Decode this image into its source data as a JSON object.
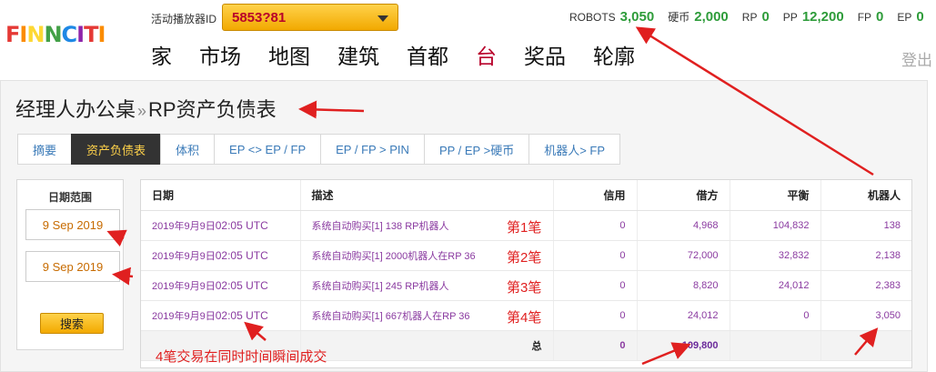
{
  "header": {
    "logo_text": "FINNCITI",
    "logo_colors": [
      "#e53935",
      "#fb8c00",
      "#fdd835",
      "#43a047",
      "#1e88e5",
      "#8e24aa",
      "#e53935",
      "#fb8c00"
    ],
    "player_label": "活动播放器ID",
    "player_id": "5853?81",
    "stats": [
      {
        "label": "ROBOTS",
        "value": "3,050"
      },
      {
        "label": "硬币",
        "value": "2,000"
      },
      {
        "label": "RP",
        "value": "0"
      },
      {
        "label": "PP",
        "value": "12,200"
      },
      {
        "label": "FP",
        "value": "0"
      },
      {
        "label": "EP",
        "value": "0"
      }
    ],
    "nav": [
      {
        "label": "家",
        "active": false
      },
      {
        "label": "市场",
        "active": false
      },
      {
        "label": "地图",
        "active": false
      },
      {
        "label": "建筑",
        "active": false
      },
      {
        "label": "首都",
        "active": false
      },
      {
        "label": "台",
        "active": true
      },
      {
        "label": "奖品",
        "active": false
      },
      {
        "label": "轮廓",
        "active": false
      }
    ],
    "logout": "登出"
  },
  "page": {
    "breadcrumb_parent": "经理人办公桌",
    "breadcrumb_sep": "»",
    "breadcrumb_current": "RP资产负债表"
  },
  "tabs": [
    {
      "label": "摘要",
      "active": false
    },
    {
      "label": "资产负债表",
      "active": true
    },
    {
      "label": "体积",
      "active": false
    },
    {
      "label": "EP <> EP / FP",
      "active": false
    },
    {
      "label": "EP / FP > PIN",
      "active": false
    },
    {
      "label": "PP / EP >硬币",
      "active": false
    },
    {
      "label": "机器人> FP",
      "active": false
    }
  ],
  "filter": {
    "heading": "日期范围",
    "start_date": "9 Sep 2019",
    "end_date": "9 Sep 2019",
    "search_label": "搜索"
  },
  "ledger": {
    "columns": [
      "日期",
      "描述",
      "信用",
      "借方",
      "平衡",
      "机器人"
    ],
    "rows": [
      {
        "date": "2019年9月9日",
        "time": "02:05 UTC",
        "desc": "系统自动购买[1] 138 RP机器人",
        "credit": "0",
        "debit": "4,968",
        "balance": "104,832",
        "robots": "138"
      },
      {
        "date": "2019年9月9日",
        "time": "02:05 UTC",
        "desc": "系统自动购买[1] 2000机器人在RP 36",
        "credit": "0",
        "debit": "72,000",
        "balance": "32,832",
        "robots": "2,138"
      },
      {
        "date": "2019年9月9日",
        "time": "02:05 UTC",
        "desc": "系统自动购买[1] 245 RP机器人",
        "credit": "0",
        "debit": "8,820",
        "balance": "24,012",
        "robots": "2,383"
      },
      {
        "date": "2019年9月9日",
        "time": "02:05 UTC",
        "desc": "系统自动购买[1] 667机器人在RP 36",
        "credit": "0",
        "debit": "24,012",
        "balance": "0",
        "robots": "3,050"
      }
    ],
    "total_label": "总",
    "total_credit": "0",
    "total_debit": "109,800"
  },
  "annotations": {
    "row_labels": [
      "第1笔",
      "第2笔",
      "第3笔",
      "第4笔"
    ],
    "footnote": "4笔交易在同时时间瞬间成交",
    "color": "#e02020"
  }
}
